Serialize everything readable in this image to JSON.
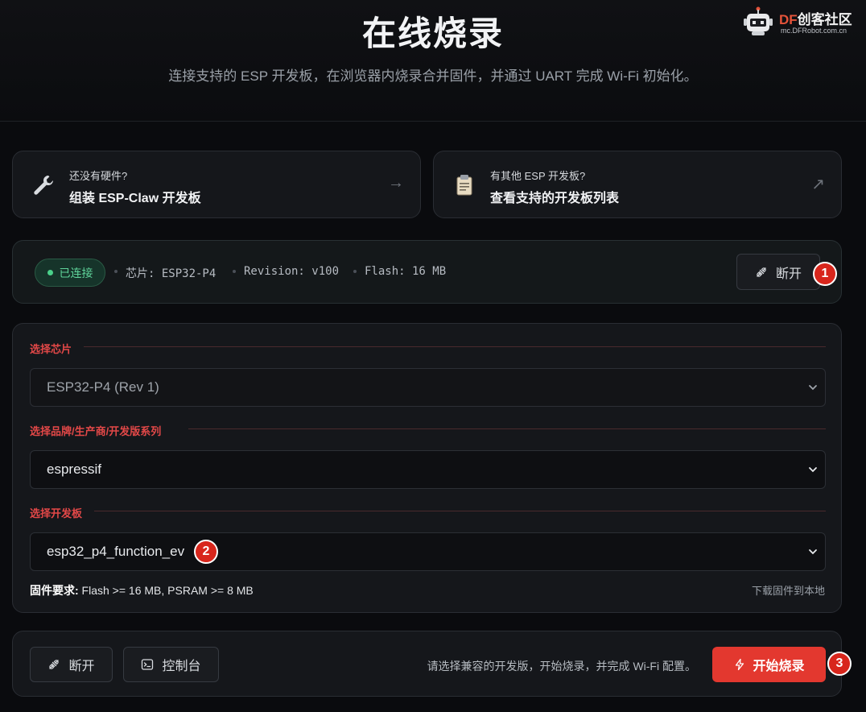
{
  "header": {
    "title": "在线烧录",
    "subtitle": "连接支持的 ESP 开发板，在浏览器内烧录合并固件，并通过 UART 完成 Wi-Fi 初始化。",
    "logo": {
      "brand_df": "DF",
      "brand_rest": "创客社区",
      "site": "mc.DFRobot.com.cn"
    }
  },
  "links": [
    {
      "subtitle": "还没有硬件?",
      "title": "组装 ESP-Claw 开发板",
      "icon": "wrench-icon",
      "arrow": "→"
    },
    {
      "subtitle": "有其他 ESP 开发板?",
      "title": "查看支持的开发板列表",
      "icon": "clipboard-icon",
      "arrow": "↗"
    }
  ],
  "connection": {
    "status": "已连接",
    "chip": "芯片: ESP32-P4",
    "revision": "Revision: v100",
    "flash": "Flash: 16 MB",
    "disconnect_label": "断开",
    "step": "1"
  },
  "form": {
    "chip_label": "选择芯片",
    "chip_value": "ESP32-P4 (Rev 1)",
    "brand_label": "选择品牌/生产商/开发版系列",
    "brand_value": "espressif",
    "board_label": "选择开发板",
    "board_value": "esp32_p4_function_ev",
    "board_step": "2",
    "requirement_label": "固件要求:",
    "requirement_value": " Flash >= 16 MB, PSRAM >= 8 MB",
    "download_label": "下载固件到本地"
  },
  "actions": {
    "disconnect_label": "断开",
    "console_label": "控制台",
    "hint": "请选择兼容的开发版，开始烧录，并完成 Wi-Fi 配置。",
    "flash_label": "开始烧录",
    "flash_step": "3"
  },
  "colors": {
    "accent_red": "#e3382f",
    "connected_green": "#4ad08a",
    "section_label_red": "#e34848"
  }
}
